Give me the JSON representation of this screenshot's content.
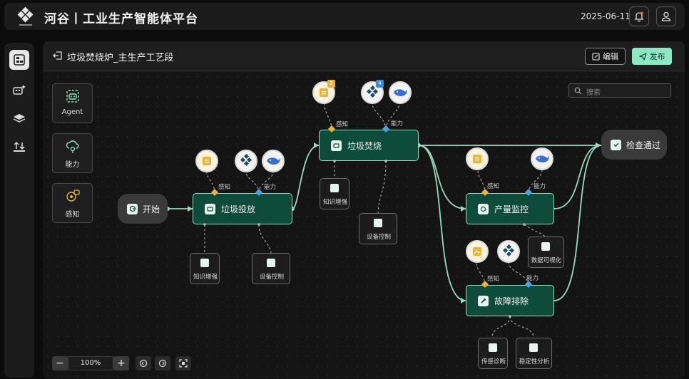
{
  "app": {
    "title": "河谷丨工业生产智能体平台",
    "date": "2025-06-11"
  },
  "colors": {
    "accent": "#8ee8c3",
    "node_fill": "#0f4b3b",
    "perception_diamond": "#e9b43a",
    "capability_diamond": "#4aa3e0"
  },
  "header": {
    "title": "垃圾焚烧炉_主生产工艺段",
    "edit_label": "编辑",
    "publish_label": "发布"
  },
  "search": {
    "placeholder": "搜索"
  },
  "palette": [
    {
      "label": "Agent",
      "icon": "robot-icon"
    },
    {
      "label": "能力",
      "icon": "cloud-gear-icon"
    },
    {
      "label": "感知",
      "icon": "perception-icon"
    }
  ],
  "nodes": {
    "start": "开始",
    "dump": "垃圾投放",
    "incinerate": "垃圾焚烧",
    "monitor": "产量监控",
    "fault": "故障排除",
    "check": "检查通过"
  },
  "edge_labels": {
    "perception": "感知",
    "capability": "能力"
  },
  "tags": {
    "knowledge": "知识增强",
    "device_control": "设备控制",
    "data_viz": "数据可视化",
    "sensor_diag": "传感诊断",
    "stability": "稳定性分析"
  },
  "badges": {
    "incinerate_doc": "2",
    "incinerate_grid": "4"
  },
  "zoom": {
    "value": "100%",
    "minus": "−",
    "plus": "+"
  }
}
